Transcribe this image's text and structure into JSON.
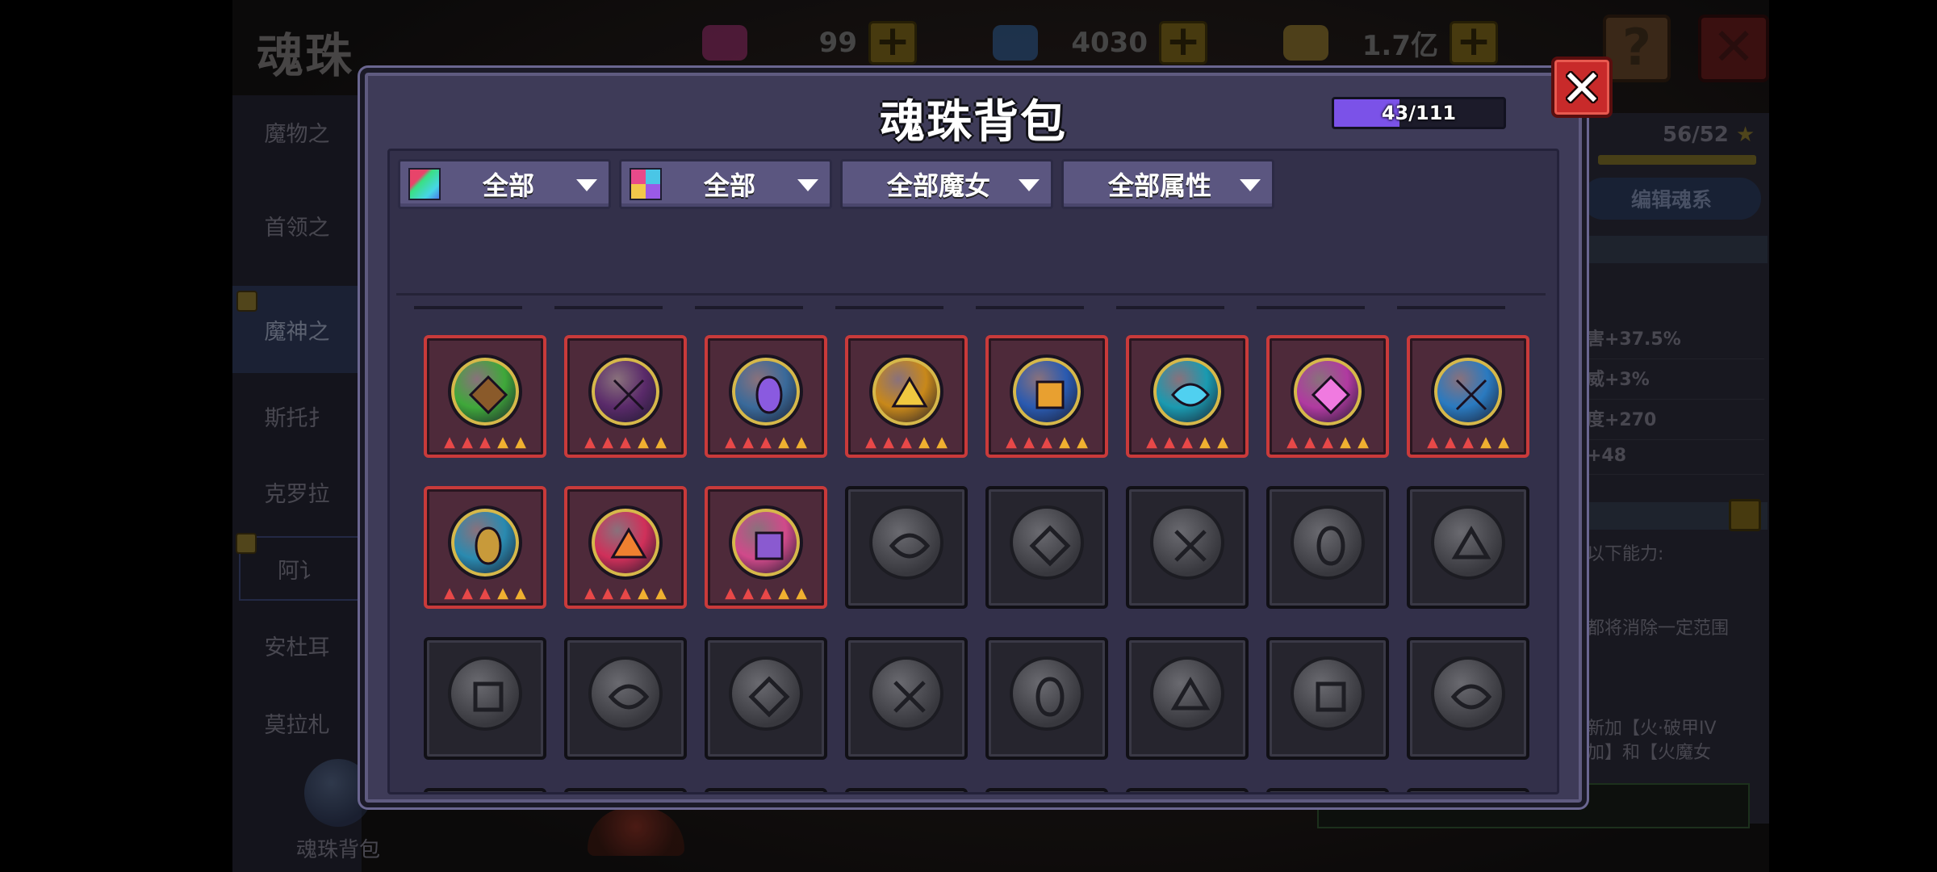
{
  "background": {
    "title": "魂珠",
    "currencies": [
      {
        "icon": "pink-gem-icon",
        "value": "99",
        "color": "#c23a8a"
      },
      {
        "icon": "blue-gem-icon",
        "value": "4030",
        "color": "#3a7ac2"
      },
      {
        "icon": "gold-coin-icon",
        "value": "1.7亿",
        "color": "#c2a23a"
      }
    ],
    "help_label": "?",
    "sidebar": [
      {
        "label": "魔物之",
        "active": false,
        "marker": false
      },
      {
        "label": "首领之",
        "active": false,
        "marker": false
      },
      {
        "label": "魔神之",
        "active": true,
        "marker": true
      },
      {
        "label": "斯托扌",
        "active": false,
        "marker": false
      },
      {
        "label": "克罗拉",
        "active": false,
        "marker": false
      },
      {
        "label": "阿讠",
        "active": false,
        "marker": true,
        "boxed": true
      },
      {
        "label": "安杜耳",
        "active": false,
        "marker": false
      },
      {
        "label": "莫拉札",
        "active": false,
        "marker": false
      }
    ],
    "bag_label": "魂珠背包",
    "right_panel": {
      "stars": "56/52",
      "star_glyph": "★",
      "edit_label": "编辑魂系",
      "stats": [
        "害+37.5%",
        "威+3%",
        "度+270",
        "+48"
      ],
      "ability_label": "以下能力:",
      "desc_1": "都将消除一定范围",
      "desc_2": "新加【火·破甲IV",
      "desc_3": "加】和【火魔女"
    }
  },
  "modal": {
    "title": "魂珠背包",
    "capacity": {
      "text": "43/111",
      "used": 43,
      "total": 111
    },
    "filters": [
      {
        "label": "全部",
        "icon": "rainbow-quality-icon"
      },
      {
        "label": "全部",
        "icon": "color-quad-icon"
      },
      {
        "label": "全部魔女",
        "icon": ""
      },
      {
        "label": "全部属性",
        "icon": ""
      }
    ],
    "owned_stars": 5,
    "owned": [
      {
        "icon": "monkey-orb-icon",
        "color": "#3fa83a",
        "accent": "#8a5a2a"
      },
      {
        "icon": "pink-crystal-bird-icon",
        "color": "#5a2a6a",
        "accent": "#e84aa8"
      },
      {
        "icon": "purple-crystal-bird-icon",
        "color": "#3a6a9a",
        "accent": "#8a5ae0"
      },
      {
        "icon": "golden-beast-icon",
        "color": "#c8881a",
        "accent": "#f0c840"
      },
      {
        "icon": "ice-dragon-icon",
        "color": "#2a5ab0",
        "accent": "#e8a030"
      },
      {
        "icon": "blue-pearl-icon",
        "color": "#1a9ab0",
        "accent": "#50d0f0"
      },
      {
        "icon": "pink-pearl-icon",
        "color": "#b03aa0",
        "accent": "#f07ae0"
      },
      {
        "icon": "telescope-icon",
        "color": "#2a7ac0",
        "accent": "#e84040"
      },
      {
        "icon": "ram-orb-icon",
        "color": "#2a8ab0",
        "accent": "#c89a3a"
      },
      {
        "icon": "fire-demon-mask-icon",
        "color": "#d0305a",
        "accent": "#f08030"
      },
      {
        "icon": "purple-demon-mask-icon",
        "color": "#d04a8a",
        "accent": "#8a5ad0"
      }
    ],
    "empty": [
      "axe-silhouette-icon",
      "blade-silhouette-icon",
      "scroll-silhouette-icon",
      "sword-silhouette-icon",
      "chain-silhouette-icon",
      "hat-silhouette-icon",
      "tool-silhouette-icon",
      "drill-silhouette-icon",
      "totem-silhouette-icon",
      "beast-silhouette-icon",
      "spear-silhouette-icon",
      "dragon-silhouette-icon",
      "staff-silhouette-icon",
      "dragon-silhouette-icon",
      "serpent-silhouette-icon",
      "beast-silhouette-icon",
      "warrior-silhouette-icon",
      "sword-silhouette-icon",
      "blade-silhouette-icon",
      "fist-silhouette-icon",
      "dragon-silhouette-icon"
    ]
  }
}
